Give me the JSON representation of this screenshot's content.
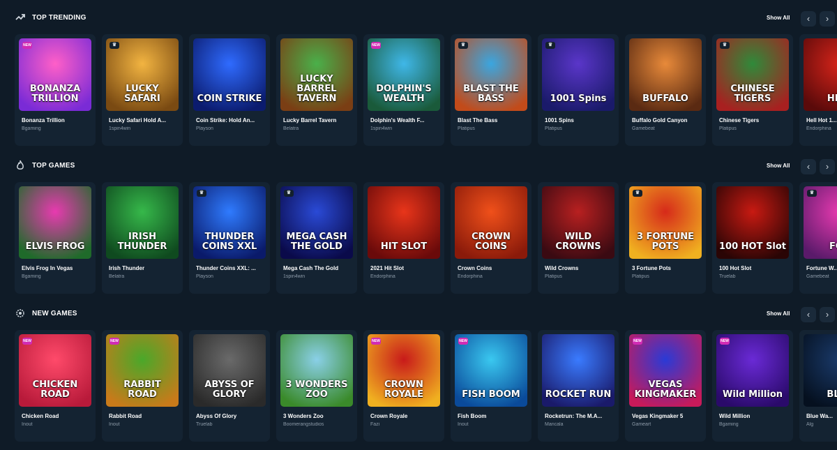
{
  "sections": [
    {
      "title": "TOP TRENDING",
      "icon": "trend-icon",
      "show_all": "Show All",
      "nav_prev": "‹",
      "nav_next": "›",
      "games": [
        {
          "name": "Bonanza Trillion",
          "provider": "Bgaming",
          "art": "BONANZA TRILLION",
          "badge": "NEW",
          "bg": [
            "#ff5fc8",
            "#7a2bd6"
          ]
        },
        {
          "name": "Lucky Safari Hold A...",
          "provider": "1spin4win",
          "art": "LUCKY SAFARI",
          "badge": "crown",
          "bg": [
            "#f2b441",
            "#7a4a12"
          ]
        },
        {
          "name": "Coin Strike: Hold An...",
          "provider": "Playson",
          "art": "COIN STRIKE",
          "badge": "",
          "bg": [
            "#2f6bff",
            "#0b1b6e"
          ]
        },
        {
          "name": "Lucky Barrel Tavern",
          "provider": "Belatra",
          "art": "LUCKY BARREL TAVERN",
          "badge": "",
          "bg": [
            "#4ab04a",
            "#7a3e14"
          ]
        },
        {
          "name": "Dolphin's Wealth F...",
          "provider": "1spin4win",
          "art": "DOLPHIN'S WEALTH",
          "badge": "NEW",
          "bg": [
            "#3fb7e8",
            "#1a5a3a"
          ]
        },
        {
          "name": "Blast The Bass",
          "provider": "Platipus",
          "art": "BLAST THE BASS",
          "badge": "crown",
          "bg": [
            "#3aa6e0",
            "#c24b1a"
          ]
        },
        {
          "name": "1001 Spins",
          "provider": "Platipus",
          "art": "1001 Spins",
          "badge": "crown",
          "bg": [
            "#5a36c9",
            "#1a1a6a"
          ]
        },
        {
          "name": "Buffalo Gold Canyon",
          "provider": "Gamebeat",
          "art": "BUFFALO",
          "badge": "",
          "bg": [
            "#e88a3a",
            "#5a2a12"
          ]
        },
        {
          "name": "Chinese Tigers",
          "provider": "Platipus",
          "art": "CHINESE TIGERS",
          "badge": "crown",
          "bg": [
            "#2f8a3a",
            "#a82020"
          ]
        },
        {
          "name": "Hell Hot 1...",
          "provider": "Endorphina",
          "art": "HELL",
          "badge": "",
          "bg": [
            "#d6241a",
            "#5a0a0a"
          ]
        }
      ]
    },
    {
      "title": "TOP GAMES",
      "icon": "fire-icon",
      "show_all": "Show All",
      "nav_prev": "‹",
      "nav_next": "›",
      "games": [
        {
          "name": "Elvis Frog In Vegas",
          "provider": "Bgaming",
          "art": "ELVIS FROG",
          "badge": "",
          "bg": [
            "#e83ab0",
            "#1f6a2a"
          ]
        },
        {
          "name": "Irish Thunder",
          "provider": "Belatra",
          "art": "IRISH THUNDER",
          "badge": "",
          "bg": [
            "#36b84a",
            "#0f4a1f"
          ]
        },
        {
          "name": "Thunder Coins XXL: ...",
          "provider": "Playson",
          "art": "THUNDER COINS XXL",
          "badge": "crown",
          "bg": [
            "#2f7bff",
            "#0a1a6a"
          ]
        },
        {
          "name": "Mega Cash The Gold",
          "provider": "1spin4win",
          "art": "MEGA CASH THE GOLD",
          "badge": "crown",
          "bg": [
            "#2a4ad6",
            "#0a0a4a"
          ]
        },
        {
          "name": "2021 Hit Slot",
          "provider": "Endorphina",
          "art": "HIT SLOT",
          "badge": "",
          "bg": [
            "#e8351a",
            "#6a0a0a"
          ]
        },
        {
          "name": "Crown Coins",
          "provider": "Endorphina",
          "art": "CROWN COINS",
          "badge": "",
          "bg": [
            "#f0501a",
            "#8a1a0a"
          ]
        },
        {
          "name": "Wild Crowns",
          "provider": "Platipus",
          "art": "WILD CROWNS",
          "badge": "",
          "bg": [
            "#b82020",
            "#3a0a12"
          ]
        },
        {
          "name": "3 Fortune Pots",
          "provider": "Platipus",
          "art": "3 FORTUNE POTS",
          "badge": "crown",
          "bg": [
            "#d62a1a",
            "#f0b020"
          ]
        },
        {
          "name": "100 Hot Slot",
          "provider": "Truelab",
          "art": "100 HOT Slot",
          "badge": "",
          "bg": [
            "#c81a12",
            "#2a0505"
          ]
        },
        {
          "name": "Fortune W...",
          "provider": "Gamebeat",
          "art": "FOR",
          "badge": "crown",
          "bg": [
            "#e83ab0",
            "#5a1a6a"
          ]
        }
      ]
    },
    {
      "title": "NEW GAMES",
      "icon": "gear-icon",
      "show_all": "Show All",
      "nav_prev": "‹",
      "nav_next": "›",
      "games": [
        {
          "name": "Chicken Road",
          "provider": "Inout",
          "art": "CHICKEN ROAD",
          "badge": "NEW",
          "bg": [
            "#ff4a6a",
            "#b81a3a"
          ]
        },
        {
          "name": "Rabbit Road",
          "provider": "Inout",
          "art": "RABBIT ROAD",
          "badge": "NEW",
          "bg": [
            "#4aa82a",
            "#c87a1a"
          ]
        },
        {
          "name": "Abyss Of Glory",
          "provider": "Truelab",
          "art": "ABYSS OF GLORY",
          "badge": "",
          "bg": [
            "#6a6a6a",
            "#2a2a2a"
          ]
        },
        {
          "name": "3 Wonders Zoo",
          "provider": "Boomerangstudios",
          "art": "3 WONDERS ZOO",
          "badge": "",
          "bg": [
            "#8ad0e8",
            "#3a8a2a"
          ]
        },
        {
          "name": "Crown Royale",
          "provider": "Fazi",
          "art": "CROWN ROYALE",
          "badge": "NEW",
          "bg": [
            "#c81a1a",
            "#f0b020"
          ]
        },
        {
          "name": "Fish Boom",
          "provider": "Inout",
          "art": "FISH BOOM",
          "badge": "NEW",
          "bg": [
            "#3ac8f0",
            "#0a4a9a"
          ]
        },
        {
          "name": "Rocketrun: The M.A...",
          "provider": "Mancala",
          "art": "ROCKET RUN",
          "badge": "",
          "bg": [
            "#3a7bff",
            "#1a1a6a"
          ]
        },
        {
          "name": "Vegas Kingmaker 5",
          "provider": "Gameart",
          "art": "VEGAS KINGMAKER",
          "badge": "NEW",
          "bg": [
            "#2a3ad6",
            "#c81a5a"
          ]
        },
        {
          "name": "Wild Million",
          "provider": "Bgaming",
          "art": "Wild Million",
          "badge": "NEW",
          "bg": [
            "#6a2ad6",
            "#2a0a6a"
          ]
        },
        {
          "name": "Blue Wa...",
          "provider": "Alg",
          "art": "BLUE",
          "badge": "",
          "bg": [
            "#1a3a6a",
            "#05101f"
          ]
        }
      ]
    }
  ]
}
